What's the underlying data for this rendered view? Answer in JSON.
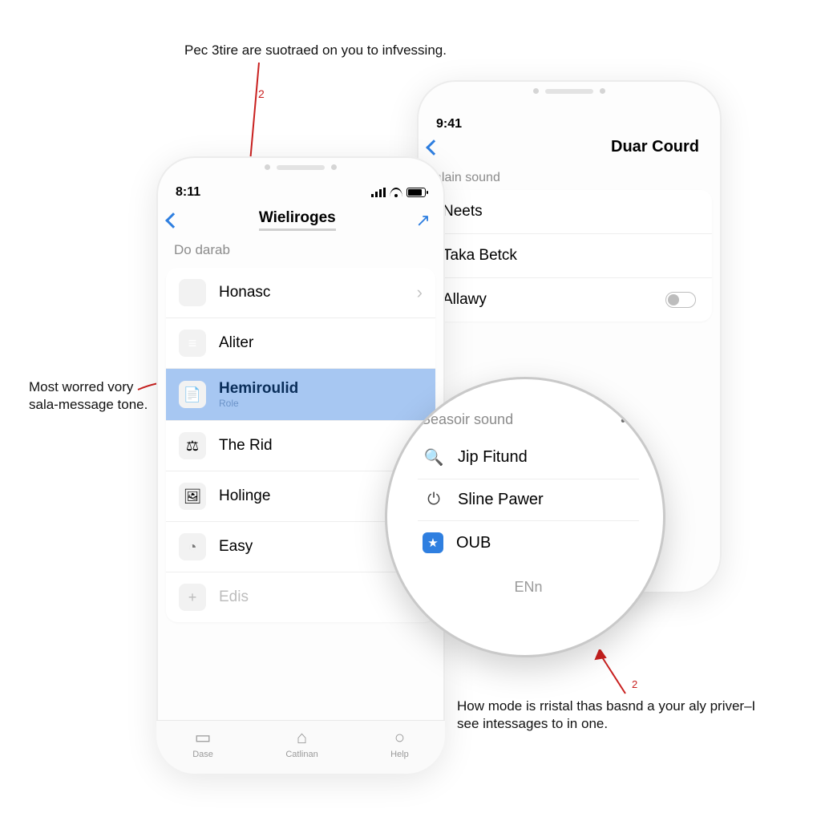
{
  "annotations": {
    "top": "Pec 3tire are suotraed on you to infvessing.",
    "left": "Most worred vory sala-message tone.",
    "bottom": "How mode is rristal thas basnd a your aly priver–I see intessages to in one.",
    "badge_top": "2",
    "badge_bottom": "2"
  },
  "phone_front": {
    "time": "8:11",
    "title": "Wieliroges",
    "subhead": "Do darab",
    "rows": [
      {
        "label": "Honasc",
        "icon": "drive-icon",
        "chevron": true
      },
      {
        "label": "Aliter",
        "icon": "list-icon",
        "chevron": false
      },
      {
        "label": "Hemiroulid",
        "sub": "Role",
        "icon": "note-icon",
        "selected": true
      },
      {
        "label": "The Rid",
        "icon": "figure-icon",
        "chevron": false
      },
      {
        "label": "Holinge",
        "icon": "card-icon",
        "chevron": false
      },
      {
        "label": "Easy",
        "icon": "clock-icon",
        "chevron": true
      },
      {
        "label": "Edis",
        "icon": "plus-icon",
        "chevron": false
      }
    ],
    "tabs": [
      "Dase",
      "Catlinan",
      "Help"
    ]
  },
  "phone_back": {
    "time": "9:41",
    "title": "Duar Courd",
    "section1": "alain sound",
    "rows1": [
      {
        "label": "Neets"
      },
      {
        "label": "Taka Betck"
      },
      {
        "label": "Allawy",
        "toggle": true
      }
    ]
  },
  "magnifier": {
    "label": "Seasoir sound",
    "rows": [
      {
        "label": "Jip Fitund",
        "icon": "search-icon"
      },
      {
        "label": "Sline Pawer",
        "icon": "power-icon"
      },
      {
        "label": "OUB",
        "icon": "star-icon"
      }
    ],
    "footer": "ENn"
  }
}
